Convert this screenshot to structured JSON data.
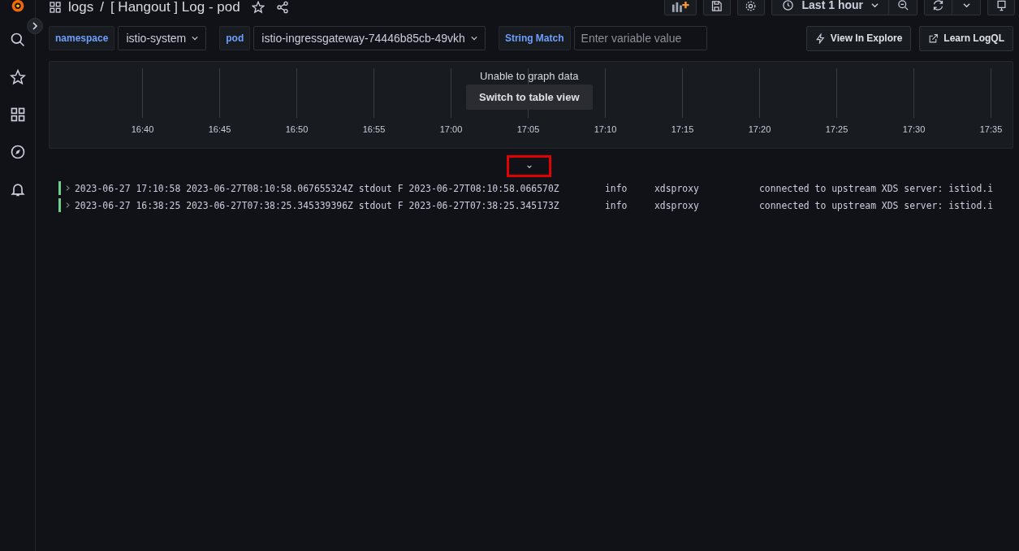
{
  "breadcrumb": {
    "folder": "logs",
    "separator": "/",
    "title": "[ Hangout ] Log - pod"
  },
  "toolbar": {
    "time_range": "Last 1 hour"
  },
  "variables": [
    {
      "kind": "select",
      "label": "namespace",
      "value": "istio-system"
    },
    {
      "kind": "select",
      "label": "pod",
      "value": "istio-ingressgateway-74446b85cb-49vkh"
    },
    {
      "kind": "text",
      "label": "String Match",
      "placeholder": "Enter variable value"
    }
  ],
  "links": [
    "View In Explore",
    "Learn LogQL"
  ],
  "graph": {
    "message": "Unable to graph data",
    "button": "Switch to table view",
    "time_ticks": [
      "16:40",
      "16:45",
      "16:50",
      "16:55",
      "17:00",
      "17:05",
      "17:10",
      "17:15",
      "17:20",
      "17:25",
      "17:30",
      "17:35"
    ]
  },
  "logs": [
    {
      "line": "2023-06-27 17:10:58 2023-06-27T08:10:58.067655324Z stdout F 2023-06-27T08:10:58.066570Z",
      "level": "info",
      "source": "xdsproxy",
      "message": "connected to upstream XDS server: istiod.i"
    },
    {
      "line": "2023-06-27 16:38:25 2023-06-27T07:38:25.345339396Z stdout F 2023-06-27T07:38:25.345173Z",
      "level": "info",
      "source": "xdsproxy",
      "message": "connected to upstream XDS server: istiod.i"
    }
  ]
}
